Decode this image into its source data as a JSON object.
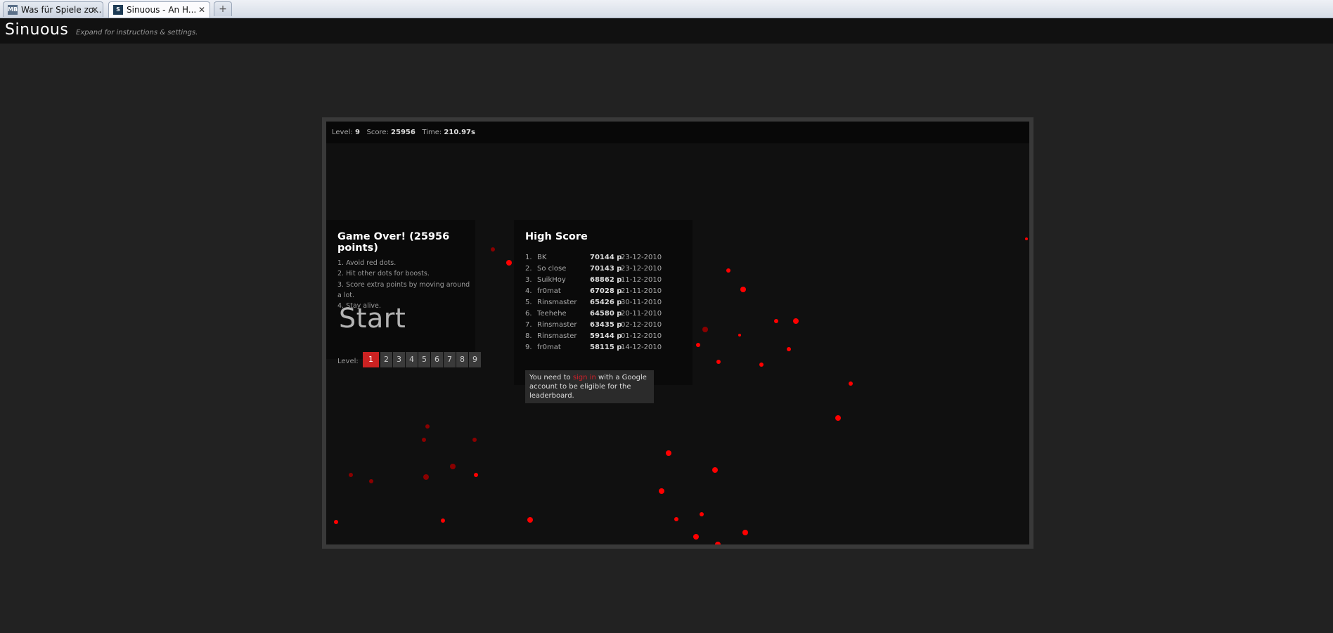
{
  "browser": {
    "tabs": [
      {
        "title": "Was für Spiele zo...",
        "favicon": "MB",
        "active": false
      },
      {
        "title": "Sinuous - An H...",
        "favicon": "S",
        "active": true
      }
    ],
    "new_tab_icon": "+"
  },
  "site": {
    "title": "Sinuous",
    "subtitle": "Expand for instructions & settings."
  },
  "hud": {
    "level_label": "Level:",
    "level": "9",
    "score_label": "Score:",
    "score": "25956",
    "time_label": "Time:",
    "time": "210.97s"
  },
  "game_over": {
    "title": "Game Over! (25956 points)",
    "instructions": [
      "1. Avoid red dots.",
      "2. Hit other dots for boosts.",
      "3. Score extra points by moving around a lot.",
      "4. Stay alive."
    ],
    "start_label": "Start",
    "level_label": "Level:",
    "levels": [
      "1",
      "2",
      "3",
      "4",
      "5",
      "6",
      "7",
      "8",
      "9"
    ],
    "selected_level": "1"
  },
  "high_score": {
    "title": "High Score",
    "rows": [
      {
        "rank": "1.",
        "name": "BK",
        "points": "70144 p",
        "date": "23-12-2010"
      },
      {
        "rank": "2.",
        "name": "So close",
        "points": "70143 p",
        "date": "23-12-2010"
      },
      {
        "rank": "3.",
        "name": "SuikHoy",
        "points": "68862 p",
        "date": "11-12-2010"
      },
      {
        "rank": "4.",
        "name": "fr0mat",
        "points": "67028 p",
        "date": "21-11-2010"
      },
      {
        "rank": "5.",
        "name": "Rinsmaster",
        "points": "65426 p",
        "date": "30-11-2010"
      },
      {
        "rank": "6.",
        "name": "Teehehe",
        "points": "64580 p",
        "date": "20-11-2010"
      },
      {
        "rank": "7.",
        "name": "Rinsmaster",
        "points": "63435 p",
        "date": "02-12-2010"
      },
      {
        "rank": "8.",
        "name": "Rinsmaster",
        "points": "59144 p",
        "date": "01-12-2010"
      },
      {
        "rank": "9.",
        "name": "fr0mat",
        "points": "58115 p",
        "date": "14-12-2010"
      }
    ],
    "signin_before": "You need to ",
    "signin_link": "sign in",
    "signin_after": " with a Google account to be eligible for the leaderboard."
  },
  "colors": {
    "dot": "#ff0000",
    "dot_dim": "#8a0000",
    "accent": "#cc2222"
  }
}
